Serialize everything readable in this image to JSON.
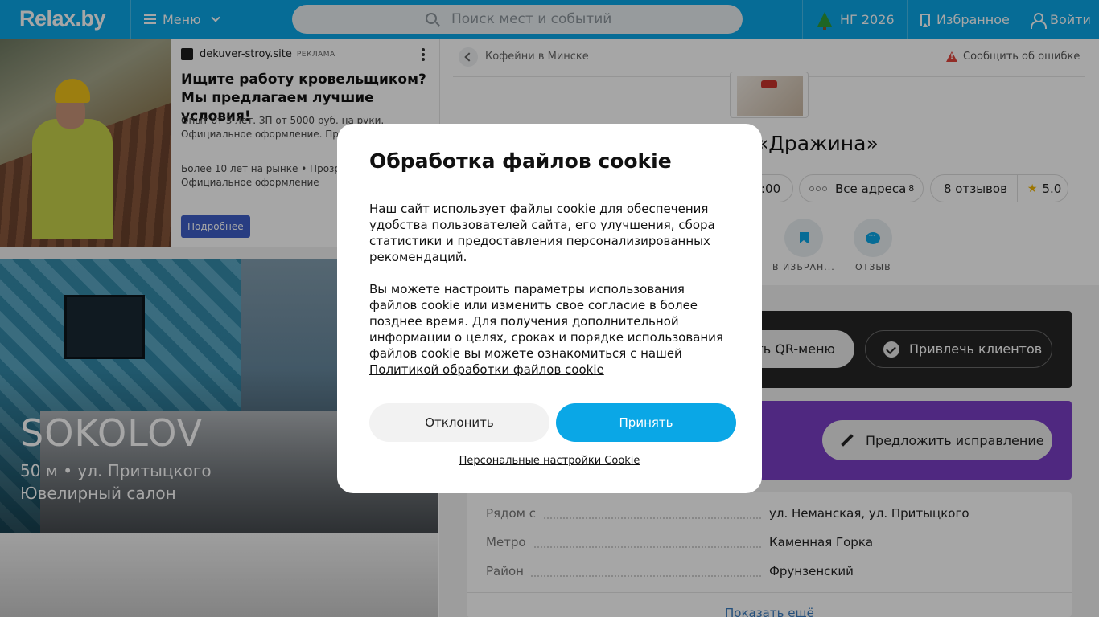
{
  "header": {
    "logo": "Relax.by",
    "menu_label": "Меню",
    "search_placeholder": "Поиск мест и событий",
    "ny_label": "НГ 2026",
    "favorites_label": "Избранное",
    "login_label": "Войти"
  },
  "ad": {
    "source": "dekuver-stroy.site",
    "tag": "РЕКЛАМА",
    "title": "Ищите работу кровельщиком? Мы предлагаем лучшие условия!",
    "text": "Опыт от 3 лет. ЗП от 5000 руб. на руки. Официальное оформление. Приходите к нам!",
    "text2": "Более 10 лет на рынке • Прозрачные оплаты • Официальное оформление",
    "button": "Подробнее"
  },
  "promo": {
    "title": "SOKOLOV",
    "line1": "50 м • ул. Притыцкого",
    "line2": "Ювелирный салон"
  },
  "place": {
    "breadcrumb": "Кофейни в Минске",
    "report": "Сообщить об ошибке",
    "title": "«Дражина»",
    "hours_fragment": ":00",
    "all_addresses": "Все адреса",
    "addresses_count": "8",
    "reviews": "8 отзывов",
    "rating": "5.0",
    "action_fav": "В ИЗБРАН...",
    "action_review": "ОТЗЫВ",
    "qr_button": "ть QR-меню",
    "attract_button": "Привлечь клиентов",
    "suggest_button": "Предложить исправление",
    "info": [
      {
        "key": "Рядом с",
        "value": "ул. Неманская, ул. Притыцкого"
      },
      {
        "key": "Метро",
        "value": "Каменная Горка"
      },
      {
        "key": "Район",
        "value": "Фрунзенский"
      }
    ],
    "show_more": "Показать ещё"
  },
  "cookie": {
    "title": "Обработка файлов cookie",
    "para1": "Наш сайт использует файлы cookie для обеспечения удобства пользователей сайта, его улучшения, сбора статистики и предоставления персонализированных рекомендаций.",
    "para2": "Вы можете настроить параметры использования файлов cookie или изменить свое согласие в более позднее время. Для получения дополнительной информации о целях, сроках и порядке использования файлов cookie вы можете ознакомиться с нашей",
    "policy_link": "Политикой обработки файлов cookie",
    "decline": "Отклонить",
    "accept": "Принять",
    "settings": "Персональные настройки Cookie"
  },
  "colors": {
    "brand": "#0aa7e6",
    "purple": "#7a3ec5",
    "dark": "#262626"
  }
}
